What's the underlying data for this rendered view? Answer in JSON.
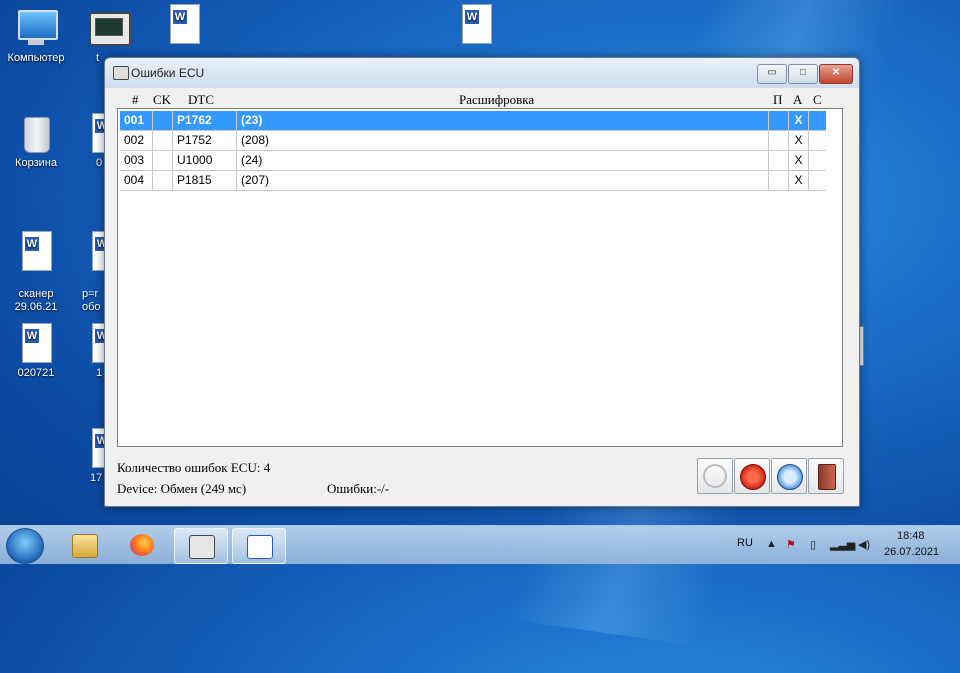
{
  "desktop": {
    "icons": [
      {
        "label": "Компьютер",
        "kind": "monitor"
      },
      {
        "label": "Корзина",
        "kind": "recycle"
      },
      {
        "label": "сканер\n29.06.21",
        "kind": "doc"
      },
      {
        "label": "020721",
        "kind": "doc"
      }
    ],
    "partial_labels": [
      "t",
      "0",
      "p=r\nобо",
      "1",
      "17"
    ]
  },
  "window": {
    "title": "Ошибки ECU",
    "controls": {
      "minimize": "▭",
      "maximize": "□",
      "close": "✕"
    },
    "columns": [
      "#",
      "CK",
      "DTC",
      "Расшифровка",
      "П",
      "А",
      "С"
    ],
    "rows": [
      {
        "num": "001",
        "ck": "",
        "dtc": "P1762",
        "desc": "(23)",
        "p": "",
        "a": "X",
        "c": "",
        "selected": true
      },
      {
        "num": "002",
        "ck": "",
        "dtc": "P1752",
        "desc": "(208)",
        "p": "",
        "a": "X",
        "c": "",
        "selected": false
      },
      {
        "num": "003",
        "ck": "",
        "dtc": "U1000",
        "desc": "(24)",
        "p": "",
        "a": "X",
        "c": "",
        "selected": false
      },
      {
        "num": "004",
        "ck": "",
        "dtc": "P1815",
        "desc": "(207)",
        "p": "",
        "a": "X",
        "c": "",
        "selected": false
      }
    ],
    "status": {
      "error_count": "Количество ошибок ECU: 4",
      "device": "Device:  Обмен (249 мс)",
      "errors": "Ошибки:-/-"
    },
    "toolbar": [
      "timer-icon",
      "clear-errors-icon",
      "save-report-icon",
      "exit-icon"
    ],
    "selection_color": "#3399ff"
  },
  "taskbar": {
    "language": "RU",
    "time": "18:48",
    "date": "26.07.2021"
  }
}
